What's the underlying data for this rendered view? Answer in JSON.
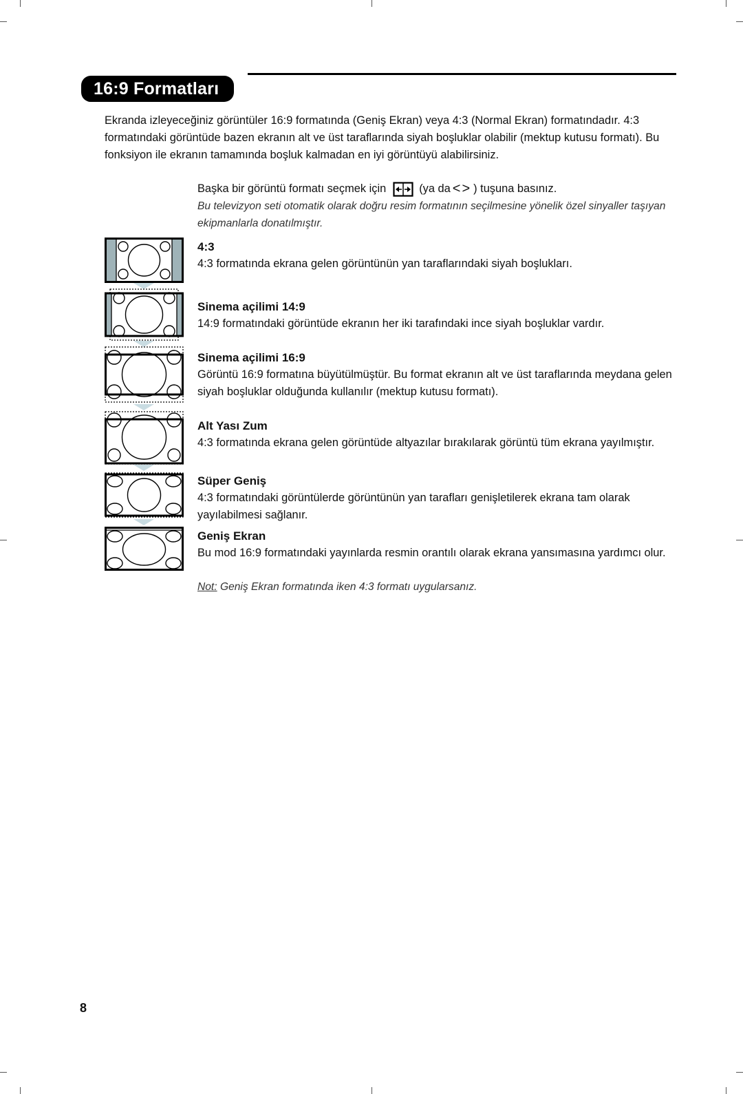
{
  "header": {
    "title": "16:9 Formatları"
  },
  "intro": "Ekranda izleyeceğiniz görüntüler 16:9 formatında (Geniş Ekran) veya 4:3 (Normal Ekran) formatındadır. 4:3 formatındaki görüntüde bazen ekranın alt ve üst taraflarında siyah boşluklar olabilir (mektup kutusu formatı). Bu fonksiyon ile ekranın tamamında boşluk kalmadan en iyi görüntüyü alabilirsiniz.",
  "instruction": {
    "before": "Başka bir görüntü formatı seçmek için",
    "key_icon": "format-key-icon",
    "middle": "(ya da",
    "arrows": "<>",
    "after": ") tuşuna basınız."
  },
  "auto_note": "Bu televizyon seti otomatik olarak doğru resim formatının seçilmesine yönelik özel sinyaller taşıyan ekipmanlarla donatılmıştır.",
  "formats": [
    {
      "title": "4:3",
      "description": "4:3 formatında ekrana gelen görüntünün yan taraflarındaki siyah boşlukları.",
      "icon": "format-4-3-icon"
    },
    {
      "title": "Sinema açilimi 14:9",
      "description": "14:9 formatındaki görüntüde ekranın her iki tarafındaki ince siyah boşluklar vardır.",
      "icon": "format-14-9-icon"
    },
    {
      "title": "Sinema açilimi 16:9",
      "description": "Görüntü 16:9 formatına büyütülmüştür. Bu format ekranın alt ve üst taraflarında meydana gelen siyah boşluklar olduğunda kullanılır (mektup kutusu formatı).",
      "icon": "format-16-9-icon"
    },
    {
      "title": "Alt Yası Zum",
      "description": "4:3 formatında ekrana gelen görüntüde altyazılar bırakılarak görüntü tüm ekrana yayılmıştır.",
      "icon": "subtitle-zoom-icon"
    },
    {
      "title": "Süper Geniş",
      "description": "4:3 formatındaki görüntülerde görüntünün yan tarafları genişletilerek ekrana tam olarak yayılabilmesi sağlanır.",
      "icon": "super-wide-icon"
    },
    {
      "title": "Geniş Ekran",
      "description": "Bu mod 16:9 formatındaki yayınlarda resmin orantılı olarak ekrana yansımasına yardımcı olur.",
      "icon": "widescreen-icon"
    }
  ],
  "note": {
    "label": "Not:",
    "text": " Geniş Ekran formatında iken 4:3 formatı uygularsanız."
  },
  "page_number": "8",
  "colors": {
    "side_bar": "#9fb3b8",
    "arrow": "#c9dce2",
    "ink": "#000000"
  }
}
